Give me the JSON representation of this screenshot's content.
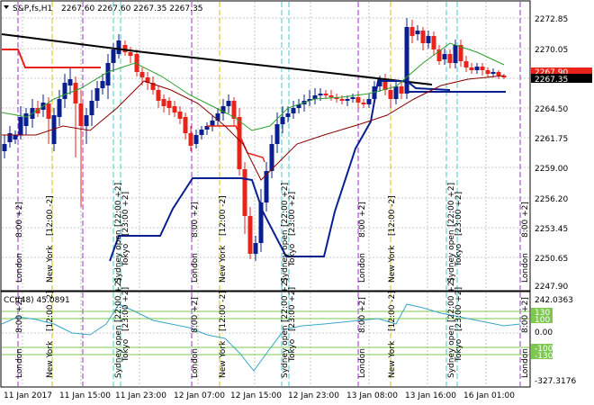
{
  "header": {
    "symbol_label": "S&P,fs,H1",
    "quote": "2267.60 2267.60 2267.35 2267.35"
  },
  "price_scale": {
    "labels": [
      "2272.85",
      "2270.05",
      "2267.90",
      "2267.35",
      "2264.50",
      "2261.75",
      "2259.00",
      "2256.20",
      "2253.45",
      "2250.65",
      "2247.90"
    ]
  },
  "cci_panel": {
    "title": "CCI(48) 45.0891",
    "scale_labels": [
      "242.0363",
      "130",
      "100",
      "0.00",
      "-100",
      "-130",
      "-327.3176"
    ]
  },
  "time_axis": {
    "labels": [
      "11 Jan 2017",
      "11 Jan 15:00",
      "11 Jan 23:00",
      "12 Jan 07:00",
      "12 Jan 15:00",
      "12 Jan 23:00",
      "13 Jan 08:00",
      "13 Jan 16:00",
      "16 Jan 01:00"
    ]
  },
  "session_labels": {
    "london": "London",
    "london_time": "8:00 +2]",
    "newyork": "New York",
    "newyork_time": "[12:00 -2]",
    "sydney": "Sydney open",
    "sydney_time": "[22:00 +2]",
    "tokyo": "Tokyo",
    "tokyo_time": "[23:00 +2]"
  },
  "colors": {
    "bull": "#0a1f8f",
    "bear": "#e8231a",
    "grid": "#b8b8b8",
    "ma_fast": "#2e9e2e",
    "ma_slow": "#8b0000",
    "trend": "#000000",
    "cci": "#3aa7c8",
    "cci_level": "#7ec850",
    "london": "#9b30d0",
    "newyork": "#d4c400",
    "sydney": "#4cc8c8"
  }
}
